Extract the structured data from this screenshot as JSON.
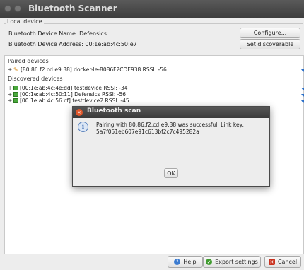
{
  "window": {
    "title": "Bluetooth Scanner"
  },
  "local_device": {
    "legend": "Local device",
    "name_text": "Bluetooth Device Name:   Defensics",
    "address_text": "Bluetooth Device Address: 00:1e:ab:4c:50:e7",
    "configure_label": "Configure...",
    "discoverable_label": "Set discoverable"
  },
  "paired": {
    "header": "Paired devices",
    "items": [
      {
        "expander": "+",
        "icon": "usb-icon",
        "text": "[80:86:f2:cd:e9:38] docker-le-8086F2CDE938 RSSI: -56"
      }
    ]
  },
  "discovered": {
    "header": "Discovered devices",
    "items": [
      {
        "expander": "+",
        "icon": "bluetooth-device-icon",
        "text": "[00:1e:ab:4c:4e:dd] testdevice RSSI: -34"
      },
      {
        "expander": "+",
        "icon": "bluetooth-device-icon",
        "text": "[00:1e:ab:4c:50:11] Defensics RSSI: -56"
      },
      {
        "expander": "+",
        "icon": "bluetooth-device-icon",
        "text": "[00:1e:ab:4c:56:cf] testdevice2 RSSI: -45"
      }
    ]
  },
  "footer": {
    "help_label": "Help",
    "export_label": "Export settings",
    "cancel_label": "Cancel"
  },
  "dialog": {
    "title": "Bluetooth scan",
    "message_line1": "Pairing with 80:86:f2:cd:e9:38 was successful. Link key:",
    "message_line2": "5a7f051eb607e91c613bf2c7c495282a",
    "ok_label": "OK"
  },
  "colors": {
    "accent_arrow": "#2a6fc9",
    "device_icon": "#4aa83c",
    "close_button": "#e0572b"
  }
}
